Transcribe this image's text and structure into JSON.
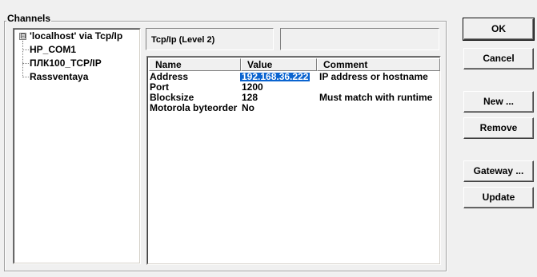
{
  "group": {
    "label": "Channels"
  },
  "tree": {
    "items": [
      {
        "label": "'localhost' via Tcp/Ip",
        "expander": "⊟"
      },
      {
        "label": "HP_COM1"
      },
      {
        "label": "ПЛК100_TCP/IP"
      },
      {
        "label": "Rassventaya"
      }
    ]
  },
  "level": {
    "label": "Tcp/Ip (Level 2)"
  },
  "grid": {
    "headers": [
      "Name",
      "Value",
      "Comment"
    ],
    "rows": [
      {
        "name": "Address",
        "value": "192.168.36.222",
        "comment": "IP address or hostname",
        "selected_col": "value"
      },
      {
        "name": "Port",
        "value": "1200",
        "comment": ""
      },
      {
        "name": "Blocksize",
        "value": "128",
        "comment": "Must match with runtime"
      },
      {
        "name": "Motorola byteorder",
        "value": "No",
        "comment": ""
      }
    ]
  },
  "buttons": {
    "ok": "OK",
    "cancel": "Cancel",
    "new": "New ...",
    "remove": "Remove",
    "gateway": "Gateway ...",
    "update": "Update"
  },
  "colors": {
    "selection": "#0a64d0",
    "face": "#f0f0f0"
  }
}
